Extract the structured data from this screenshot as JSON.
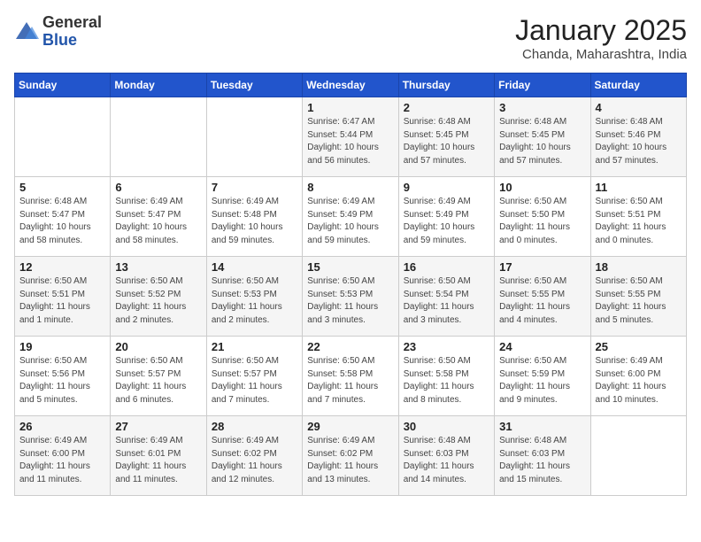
{
  "header": {
    "logo_general": "General",
    "logo_blue": "Blue",
    "month_title": "January 2025",
    "location": "Chanda, Maharashtra, India"
  },
  "weekdays": [
    "Sunday",
    "Monday",
    "Tuesday",
    "Wednesday",
    "Thursday",
    "Friday",
    "Saturday"
  ],
  "weeks": [
    [
      {
        "day": "",
        "info": ""
      },
      {
        "day": "",
        "info": ""
      },
      {
        "day": "",
        "info": ""
      },
      {
        "day": "1",
        "info": "Sunrise: 6:47 AM\nSunset: 5:44 PM\nDaylight: 10 hours and 56 minutes."
      },
      {
        "day": "2",
        "info": "Sunrise: 6:48 AM\nSunset: 5:45 PM\nDaylight: 10 hours and 57 minutes."
      },
      {
        "day": "3",
        "info": "Sunrise: 6:48 AM\nSunset: 5:45 PM\nDaylight: 10 hours and 57 minutes."
      },
      {
        "day": "4",
        "info": "Sunrise: 6:48 AM\nSunset: 5:46 PM\nDaylight: 10 hours and 57 minutes."
      }
    ],
    [
      {
        "day": "5",
        "info": "Sunrise: 6:48 AM\nSunset: 5:47 PM\nDaylight: 10 hours and 58 minutes."
      },
      {
        "day": "6",
        "info": "Sunrise: 6:49 AM\nSunset: 5:47 PM\nDaylight: 10 hours and 58 minutes."
      },
      {
        "day": "7",
        "info": "Sunrise: 6:49 AM\nSunset: 5:48 PM\nDaylight: 10 hours and 59 minutes."
      },
      {
        "day": "8",
        "info": "Sunrise: 6:49 AM\nSunset: 5:49 PM\nDaylight: 10 hours and 59 minutes."
      },
      {
        "day": "9",
        "info": "Sunrise: 6:49 AM\nSunset: 5:49 PM\nDaylight: 10 hours and 59 minutes."
      },
      {
        "day": "10",
        "info": "Sunrise: 6:50 AM\nSunset: 5:50 PM\nDaylight: 11 hours and 0 minutes."
      },
      {
        "day": "11",
        "info": "Sunrise: 6:50 AM\nSunset: 5:51 PM\nDaylight: 11 hours and 0 minutes."
      }
    ],
    [
      {
        "day": "12",
        "info": "Sunrise: 6:50 AM\nSunset: 5:51 PM\nDaylight: 11 hours and 1 minute."
      },
      {
        "day": "13",
        "info": "Sunrise: 6:50 AM\nSunset: 5:52 PM\nDaylight: 11 hours and 2 minutes."
      },
      {
        "day": "14",
        "info": "Sunrise: 6:50 AM\nSunset: 5:53 PM\nDaylight: 11 hours and 2 minutes."
      },
      {
        "day": "15",
        "info": "Sunrise: 6:50 AM\nSunset: 5:53 PM\nDaylight: 11 hours and 3 minutes."
      },
      {
        "day": "16",
        "info": "Sunrise: 6:50 AM\nSunset: 5:54 PM\nDaylight: 11 hours and 3 minutes."
      },
      {
        "day": "17",
        "info": "Sunrise: 6:50 AM\nSunset: 5:55 PM\nDaylight: 11 hours and 4 minutes."
      },
      {
        "day": "18",
        "info": "Sunrise: 6:50 AM\nSunset: 5:55 PM\nDaylight: 11 hours and 5 minutes."
      }
    ],
    [
      {
        "day": "19",
        "info": "Sunrise: 6:50 AM\nSunset: 5:56 PM\nDaylight: 11 hours and 5 minutes."
      },
      {
        "day": "20",
        "info": "Sunrise: 6:50 AM\nSunset: 5:57 PM\nDaylight: 11 hours and 6 minutes."
      },
      {
        "day": "21",
        "info": "Sunrise: 6:50 AM\nSunset: 5:57 PM\nDaylight: 11 hours and 7 minutes."
      },
      {
        "day": "22",
        "info": "Sunrise: 6:50 AM\nSunset: 5:58 PM\nDaylight: 11 hours and 7 minutes."
      },
      {
        "day": "23",
        "info": "Sunrise: 6:50 AM\nSunset: 5:58 PM\nDaylight: 11 hours and 8 minutes."
      },
      {
        "day": "24",
        "info": "Sunrise: 6:50 AM\nSunset: 5:59 PM\nDaylight: 11 hours and 9 minutes."
      },
      {
        "day": "25",
        "info": "Sunrise: 6:49 AM\nSunset: 6:00 PM\nDaylight: 11 hours and 10 minutes."
      }
    ],
    [
      {
        "day": "26",
        "info": "Sunrise: 6:49 AM\nSunset: 6:00 PM\nDaylight: 11 hours and 11 minutes."
      },
      {
        "day": "27",
        "info": "Sunrise: 6:49 AM\nSunset: 6:01 PM\nDaylight: 11 hours and 11 minutes."
      },
      {
        "day": "28",
        "info": "Sunrise: 6:49 AM\nSunset: 6:02 PM\nDaylight: 11 hours and 12 minutes."
      },
      {
        "day": "29",
        "info": "Sunrise: 6:49 AM\nSunset: 6:02 PM\nDaylight: 11 hours and 13 minutes."
      },
      {
        "day": "30",
        "info": "Sunrise: 6:48 AM\nSunset: 6:03 PM\nDaylight: 11 hours and 14 minutes."
      },
      {
        "day": "31",
        "info": "Sunrise: 6:48 AM\nSunset: 6:03 PM\nDaylight: 11 hours and 15 minutes."
      },
      {
        "day": "",
        "info": ""
      }
    ]
  ]
}
